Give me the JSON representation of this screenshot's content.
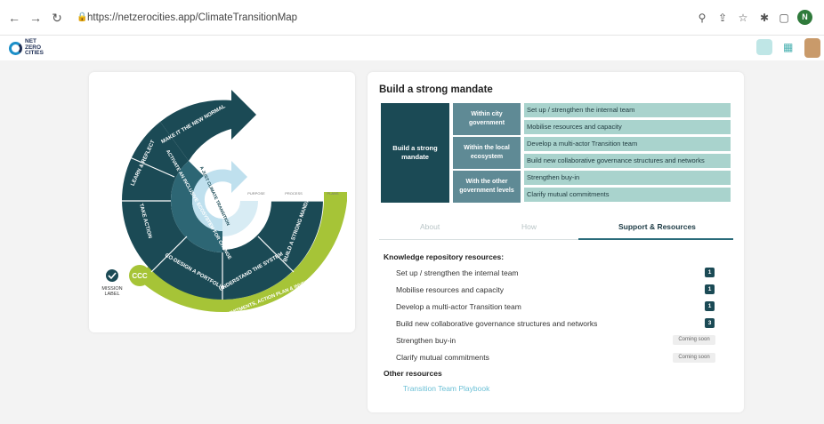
{
  "browser": {
    "url": "https://netzerocities.app/ClimateTransitionMap",
    "profile_initial": "N"
  },
  "app": {
    "logo_lines": [
      "NET",
      "ZERO",
      "CITIES"
    ]
  },
  "map": {
    "segments": [
      "MAKE IT THE NEW NORMAL",
      "LEARN & REFLECT",
      "TAKE ACTION",
      "CO-DESIGN A PORTFOLIO",
      "UNDERSTAND THE SYSTEM",
      "BUILD A STRONG MANDATE"
    ],
    "inner_ring": "ACTIVATE AN INCLUSIVE ECOSYSTEM FOR CHANGE",
    "core": "A JUST CLIMATE TRANSITION",
    "outer_ring": "2030 CLIMATE COMMITMENTS, ACTION PLAN & INVESTMENT PLAN",
    "layer_labels": [
      "PURPOSE",
      "PROCESS",
      "PLANS"
    ],
    "ccc": "CCC",
    "mission_label": [
      "MISSION",
      "LABEL"
    ]
  },
  "panel": {
    "title": "Build a strong mandate",
    "mandate_box": "Build a strong mandate",
    "groups": [
      {
        "label": "Within city government",
        "items": [
          "Set up / strengthen the internal team",
          "Mobilise resources and capacity"
        ]
      },
      {
        "label": "Within the local ecosystem",
        "items": [
          "Develop a multi-actor Transition team",
          "Build new collaborative governance structures and networks"
        ]
      },
      {
        "label": "With the other government levels",
        "items": [
          "Strengthen buy-in",
          "Clarify mutual commitments"
        ]
      }
    ],
    "tabs": [
      "About",
      "How",
      "Support & Resources"
    ],
    "knowledge_title": "Knowledge repository resources:",
    "resources": [
      {
        "label": "Set up / strengthen the internal team",
        "badge": "1"
      },
      {
        "label": "Mobilise resources and capacity",
        "badge": "1"
      },
      {
        "label": "Develop a multi-actor Transition team",
        "badge": "1"
      },
      {
        "label": "Build new collaborative governance structures and networks",
        "badge": "3"
      },
      {
        "label": "Strengthen buy-in",
        "badge": "Coming soon"
      },
      {
        "label": "Clarify mutual commitments",
        "badge": "Coming soon"
      }
    ],
    "other_title": "Other resources",
    "other_link": "Transition Team Playbook"
  },
  "colors": {
    "dark_teal": "#1b4a55",
    "mid_teal": "#5f8a95",
    "light_teal": "#a9d3cd",
    "lime": "#a6c437",
    "sky": "#bfe0ee"
  }
}
